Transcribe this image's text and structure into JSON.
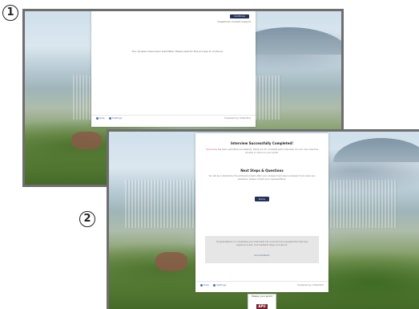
{
  "step_labels": {
    "one": "1",
    "two": "2"
  },
  "screen1": {
    "finish_button": "Continue",
    "top_right_note": "Questions? Contact support",
    "message": "Your answers have been submitted. Please wait for this process to continue.",
    "footer_help": "Help",
    "footer_settings": "Settings",
    "powered_by": "Powered by VideoTool"
  },
  "screen2": {
    "title": "Interview Successfully Completed!",
    "intro": "has been submitted successfully. Thank you for completing the interview. You can now close this window or return to your portal.",
    "next_steps_title": "Next Steps & Questions",
    "next_steps_text": "You will be contacted by the admissions team after your answers have been reviewed. If you have any questions, please contact your representative.",
    "done_button": "Done",
    "notice_text": "Congratulations on completing your interview! Let us know how enjoyable the interview experience was. Your feedback helps us improve.",
    "notice_link": "Give Feedback",
    "footer_help": "Help",
    "footer_settings": "Settings",
    "powered_by": "Powered by VideoTool",
    "logo_tagline": "Shape your world",
    "logo_mark": "APU"
  },
  "colors": {
    "accent": "#24325a",
    "link": "#4a6fb0",
    "highlight": "#d46a6a"
  }
}
